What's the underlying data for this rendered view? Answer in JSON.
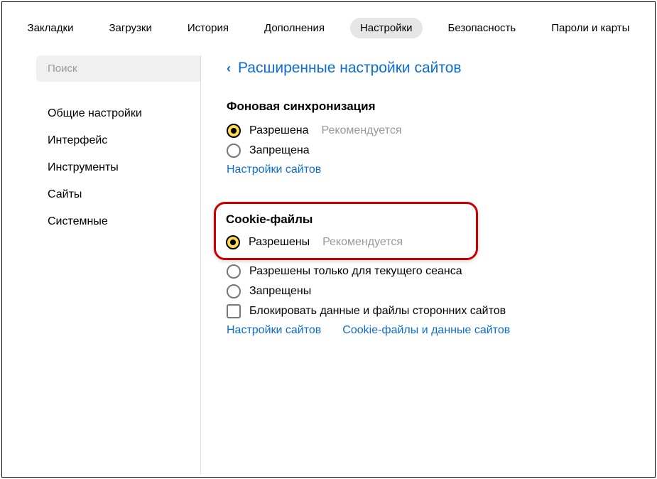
{
  "topnav": {
    "tabs": [
      {
        "label": "Закладки"
      },
      {
        "label": "Загрузки"
      },
      {
        "label": "История"
      },
      {
        "label": "Дополнения"
      },
      {
        "label": "Настройки",
        "active": true
      },
      {
        "label": "Безопасность"
      },
      {
        "label": "Пароли и карты"
      }
    ]
  },
  "sidebar": {
    "search_placeholder": "Поиск",
    "items": [
      {
        "label": "Общие настройки"
      },
      {
        "label": "Интерфейс"
      },
      {
        "label": "Инструменты"
      },
      {
        "label": "Сайты"
      },
      {
        "label": "Системные"
      }
    ]
  },
  "main": {
    "back_label": "Расширенные настройки сайтов",
    "bg_sync": {
      "title": "Фоновая синхронизация",
      "opt_allowed": "Разрешена",
      "opt_allowed_rec": "Рекомендуется",
      "opt_disallowed": "Запрещена",
      "sites_link": "Настройки сайтов"
    },
    "cookies": {
      "title": "Cookie-файлы",
      "opt_allowed": "Разрешены",
      "opt_allowed_rec": "Рекомендуется",
      "opt_session": "Разрешены только для текущего сеанса",
      "opt_blocked": "Запрещены",
      "opt_block_3p": "Блокировать данные и файлы сторонних сайтов",
      "sites_link": "Настройки сайтов",
      "data_link": "Cookie-файлы и данные сайтов"
    }
  }
}
